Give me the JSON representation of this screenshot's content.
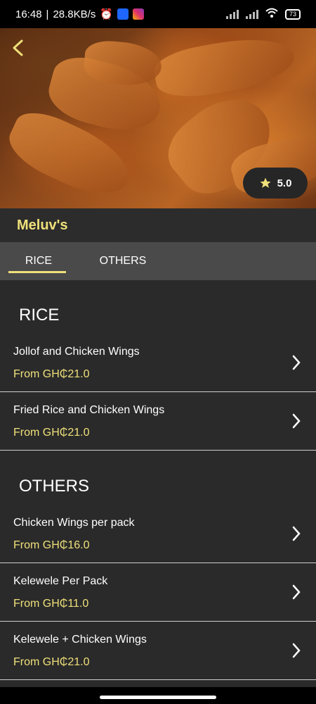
{
  "status": {
    "time": "16:48",
    "speed": "28.8KB/s",
    "battery": "73"
  },
  "header": {
    "restaurant_name": "Meluv's",
    "rating": "5.0"
  },
  "tabs": [
    {
      "label": "RICE"
    },
    {
      "label": "OTHERS"
    }
  ],
  "sections": [
    {
      "title": "RICE",
      "items": [
        {
          "name": "Jollof and Chicken Wings",
          "price": "From GH₵21.0"
        },
        {
          "name": "Fried Rice and Chicken Wings",
          "price": "From GH₵21.0"
        }
      ]
    },
    {
      "title": "OTHERS",
      "items": [
        {
          "name": "Chicken Wings per pack",
          "price": "From GH₵16.0"
        },
        {
          "name": "Kelewele Per Pack",
          "price": "From GH₵11.0"
        },
        {
          "name": "Kelewele + Chicken Wings",
          "price": "From GH₵21.0"
        }
      ]
    }
  ],
  "colors": {
    "accent": "#efe07a",
    "background": "#2a2a2a",
    "tab_bar": "#4a4a4a"
  }
}
